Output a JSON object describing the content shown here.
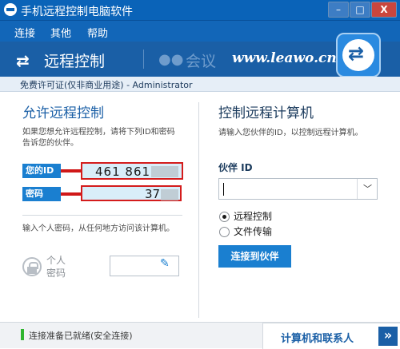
{
  "window": {
    "title": "手机远程控制电脑软件",
    "minimize": "–",
    "maximize": "□",
    "close": "X"
  },
  "menu": [
    "连接",
    "其他",
    "帮助"
  ],
  "banner": {
    "remote_control": "远程控制",
    "meeting": "会议",
    "site": "www.leawo.cn"
  },
  "license": "免费许可证(仅非商业用途) - Administrator",
  "left": {
    "heading": "允许远程控制",
    "description": "如果您想允许远程控制，请将下列ID和密码告诉您的伙伴。",
    "id_label": "您的ID",
    "id_value": "461 861",
    "password_label": "密码",
    "password_value": "37",
    "personal_description": "输入个人密码，从任何地方访问该计算机。",
    "personal_password_label": "个人密码"
  },
  "right": {
    "heading": "控制远程计算机",
    "description": "请输入您伙伴的ID，以控制远程计算机。",
    "partner_id_label": "伙伴 ID",
    "partner_id_value": "",
    "options": [
      "远程控制",
      "文件传输"
    ],
    "selected_option": "远程控制",
    "connect_button": "连接到伙伴"
  },
  "status": {
    "text": "连接准备已就绪(安全连接)",
    "state_color": "#2fb52f",
    "contacts_tab": "计算机和联系人"
  },
  "colors": {
    "accent": "#1a5fa6",
    "highlight_border": "#d41c1c"
  }
}
